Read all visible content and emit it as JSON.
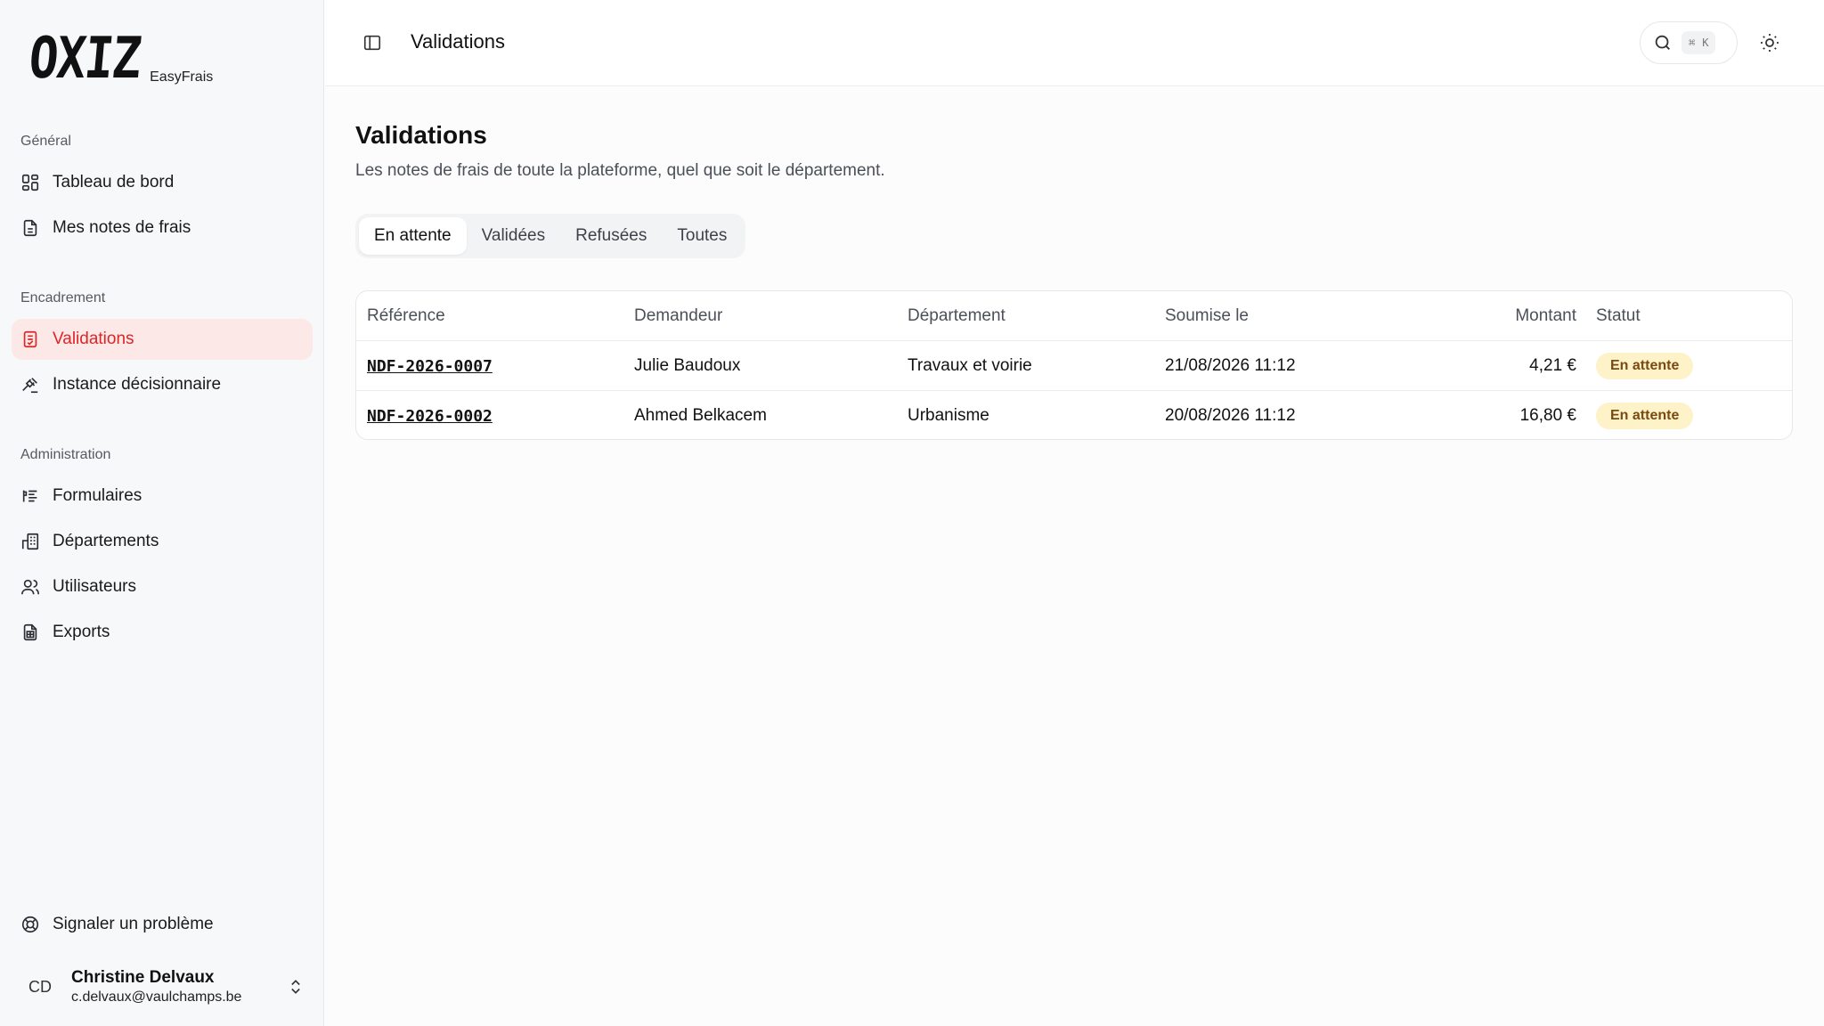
{
  "brand": {
    "logo_text": "OXIZ",
    "product": "EasyFrais"
  },
  "sidebar": {
    "groups": [
      {
        "title": "Général",
        "items": [
          {
            "label": "Tableau de bord",
            "icon": "dashboard-icon"
          },
          {
            "label": "Mes notes de frais",
            "icon": "document-icon"
          }
        ]
      },
      {
        "title": "Encadrement",
        "items": [
          {
            "label": "Validations",
            "icon": "clipboard-check-icon",
            "active": true
          },
          {
            "label": "Instance décisionnaire",
            "icon": "gavel-icon"
          }
        ]
      },
      {
        "title": "Administration",
        "items": [
          {
            "label": "Formulaires",
            "icon": "form-icon"
          },
          {
            "label": "Départements",
            "icon": "building-icon"
          },
          {
            "label": "Utilisateurs",
            "icon": "users-icon"
          },
          {
            "label": "Exports",
            "icon": "spreadsheet-icon"
          }
        ]
      }
    ],
    "report_problem": {
      "label": "Signaler un problème",
      "icon": "lifebuoy-icon"
    },
    "user": {
      "initials": "CD",
      "name": "Christine Delvaux",
      "email": "c.delvaux@vaulchamps.be"
    }
  },
  "header": {
    "title": "Validations",
    "search_shortcut": [
      "⌘",
      "K"
    ]
  },
  "page": {
    "title": "Validations",
    "subtitle": "Les notes de frais de toute la plateforme, quel que soit le département."
  },
  "tabs": [
    {
      "label": "En attente",
      "active": true
    },
    {
      "label": "Validées"
    },
    {
      "label": "Refusées"
    },
    {
      "label": "Toutes"
    }
  ],
  "table": {
    "columns": [
      "Référence",
      "Demandeur",
      "Département",
      "Soumise le",
      "Montant",
      "Statut"
    ],
    "rows": [
      {
        "reference": "NDF-2026-0007",
        "demandeur": "Julie Baudoux",
        "departement": "Travaux et voirie",
        "soumise_le": "21/08/2026 11:12",
        "montant": "4,21 €",
        "statut": "En attente"
      },
      {
        "reference": "NDF-2026-0002",
        "demandeur": "Ahmed Belkacem",
        "departement": "Urbanisme",
        "soumise_le": "20/08/2026 11:12",
        "montant": "16,80 €",
        "statut": "En attente"
      }
    ]
  },
  "colors": {
    "accent": "#dc2626",
    "active_bg": "#fde8e8",
    "badge_bg": "#fdf2c8",
    "badge_text": "#7a4a12"
  }
}
